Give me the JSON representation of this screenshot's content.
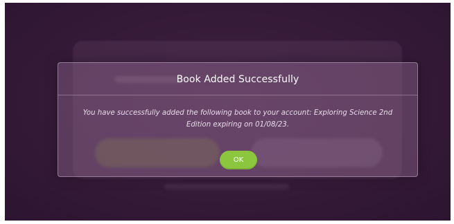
{
  "dialog": {
    "title": "Book Added Successfully",
    "message": "You have successfully added the following book to your account: Exploring Science 2nd Edition expiring on 01/08/23.",
    "ok_label": "OK"
  },
  "colors": {
    "background": "#351a37",
    "ok_button": "#8cc63f",
    "text": "#ffffff"
  }
}
